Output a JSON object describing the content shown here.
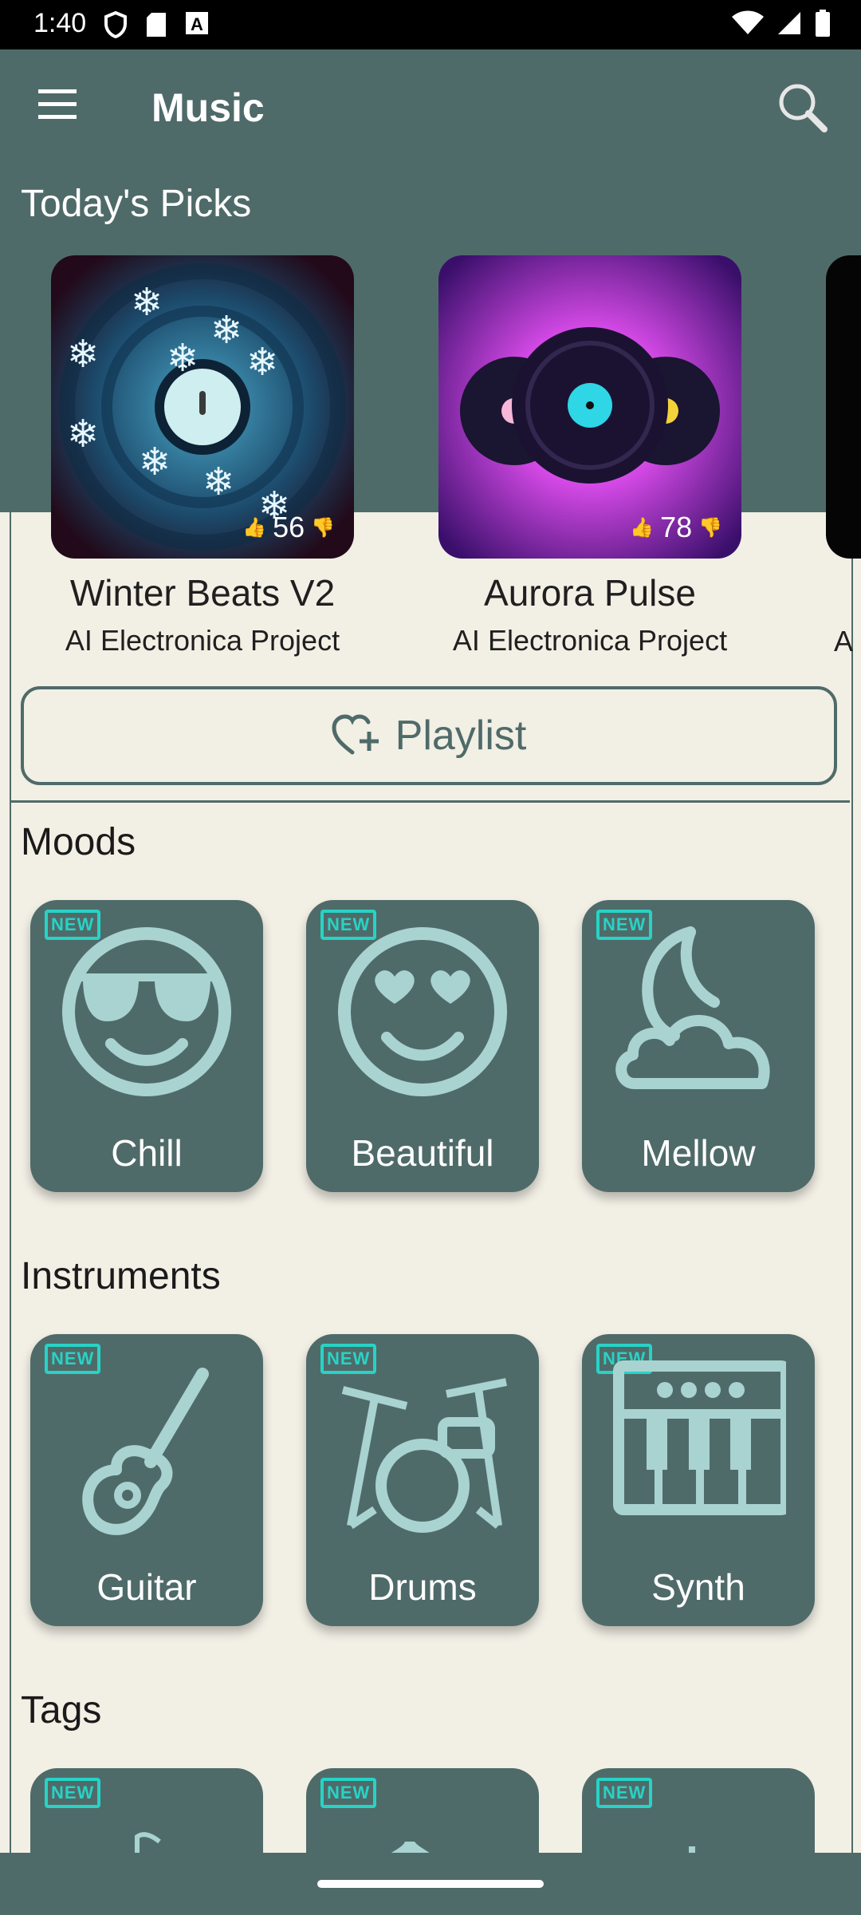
{
  "status_bar": {
    "time": "1:40",
    "left_icons": [
      "shield-icon",
      "sd-card-icon",
      "text-a-icon"
    ],
    "right_icons": [
      "wifi-icon",
      "signal-icon",
      "battery-icon"
    ]
  },
  "app_bar": {
    "title": "Music",
    "menu_icon": "hamburger-menu-icon",
    "search_icon": "search-icon"
  },
  "todays_picks": {
    "title": "Today's Picks",
    "items": [
      {
        "name": "Winter Beats V2",
        "artist": "AI Electronica Project",
        "likes": "56"
      },
      {
        "name": "Aurora Pulse",
        "artist": "AI Electronica Project",
        "likes": "78"
      }
    ],
    "partial_artist_letter": "A"
  },
  "playlist_button": {
    "label": "Playlist",
    "icon": "heart-plus-icon"
  },
  "moods": {
    "title": "Moods",
    "badge": "NEW",
    "items": [
      {
        "label": "Chill",
        "icon": "sunglasses-face-icon"
      },
      {
        "label": "Beautiful",
        "icon": "heart-eyes-face-icon"
      },
      {
        "label": "Mellow",
        "icon": "moon-cloud-icon"
      }
    ]
  },
  "instruments": {
    "title": "Instruments",
    "badge": "NEW",
    "items": [
      {
        "label": "Guitar",
        "icon": "guitar-icon"
      },
      {
        "label": "Drums",
        "icon": "drums-icon"
      },
      {
        "label": "Synth",
        "icon": "synth-keyboard-icon"
      }
    ]
  },
  "tags": {
    "title": "Tags",
    "badge": "NEW"
  },
  "colors": {
    "primary": "#4f6b69",
    "background": "#f2efe5",
    "icon": "#a8d3d1",
    "badge": "#27d3c6"
  }
}
